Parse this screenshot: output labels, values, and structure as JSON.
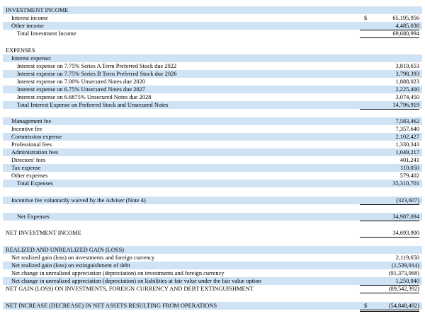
{
  "investment_income": {
    "header": "INVESTMENT INCOME",
    "interest_income": {
      "label": "Interest income",
      "dollar": "$",
      "value": "65,195,956"
    },
    "other_income": {
      "label": "Other income",
      "value": "4,485,038"
    },
    "total": {
      "label": "Total Investment Income",
      "value": "69,680,994"
    }
  },
  "expenses": {
    "header": "EXPENSES",
    "interest_expense_header": "Interest expense:",
    "interest_items": [
      {
        "label": "Interest expense on 7.75% Series A Term Preferred Stock due 2022",
        "value": "3,810,653"
      },
      {
        "label": "Interest expense on 7.75% Series B Term Preferred Stock due 2026",
        "value": "3,798,393"
      },
      {
        "label": "Interest expense on 7.00% Unsecured Notes due 2020",
        "value": "1,888,023"
      },
      {
        "label": "Interest expense on 6.75% Unsecured Notes due 2027",
        "value": "2,225,400"
      },
      {
        "label": "Interest expense on 6.6875% Unsecured Notes due 2028",
        "value": "3,074,450"
      }
    ],
    "total_interest": {
      "label": "Total Interest Expense on Preferred Stock and Unsecured Notes",
      "value": "14,796,919"
    },
    "other_items": [
      {
        "label": "Management fee",
        "value": "7,583,462"
      },
      {
        "label": "Incentive fee",
        "value": "7,357,640"
      },
      {
        "label": "Commission expense",
        "value": "2,102,427"
      },
      {
        "label": "Professional fees",
        "value": "1,330,343"
      },
      {
        "label": "Administration fees",
        "value": "1,049,217"
      },
      {
        "label": "Directors' fees",
        "value": "401,241"
      },
      {
        "label": "Tax expense",
        "value": "110,050"
      },
      {
        "label": "Other expenses",
        "value": "579,402"
      }
    ],
    "total_expenses": {
      "label": "Total Expenses",
      "value": "35,310,701"
    },
    "waiver": {
      "label": "Incentive fee voluntarily waived by the Adviser (Note 4)",
      "value": "(323,607)"
    },
    "net_expenses": {
      "label": "Net Expenses",
      "value": "34,987,094"
    }
  },
  "net_investment_income": {
    "label": "NET INVESTMENT INCOME",
    "value": "34,693,900"
  },
  "gains": {
    "header": "REALIZED AND UNREALIZED GAIN (LOSS)",
    "items": [
      {
        "label": "Net realized gain (loss) on investments and foreign currency",
        "value": "2,119,650"
      },
      {
        "label": "Net realized gain (loss) on extinguishment of debt",
        "value": "(1,539,914)"
      },
      {
        "label": "Net change in unrealized appreciation (depreciation) on investments and foreign currency",
        "value": "(91,373,068)"
      },
      {
        "label": "Net change in unrealized appreciation (depreciation) on liabilities at fair value under the fair value option",
        "value": "1,250,940"
      }
    ],
    "net_gain": {
      "label": "NET GAIN (LOSS) ON INVESTMENTS, FOREIGN CURRENCY AND DEBT EXTINGUISHMENT",
      "value": "(89,542,392)"
    }
  },
  "net_change": {
    "label": "NET INCREASE (DECREASE) IN NET ASSETS RESULTING FROM OPERATIONS",
    "dollar": "$",
    "value": "(54,848,492)"
  }
}
